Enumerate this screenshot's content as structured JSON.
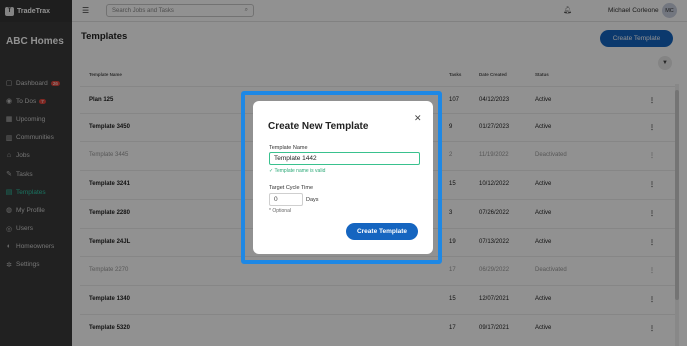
{
  "app": {
    "logo_text": "TradeTrax",
    "company": "ABC Homes"
  },
  "sidebar": {
    "items": [
      {
        "label": "Dashboard",
        "icon": "dashboard-icon",
        "glyph": "▢",
        "badge": "26"
      },
      {
        "label": "To Dos",
        "icon": "todo-icon",
        "glyph": "◉",
        "badge": "7"
      },
      {
        "label": "Upcoming",
        "icon": "calendar-icon",
        "glyph": "▦",
        "badge": ""
      },
      {
        "label": "Communities",
        "icon": "building-icon",
        "glyph": "▥",
        "badge": ""
      },
      {
        "label": "Jobs",
        "icon": "home-icon",
        "glyph": "⌂",
        "badge": ""
      },
      {
        "label": "Tasks",
        "icon": "wrench-icon",
        "glyph": "✎",
        "badge": ""
      },
      {
        "label": "Templates",
        "icon": "templates-icon",
        "glyph": "▤",
        "badge": "",
        "active": true
      },
      {
        "label": "My Profile",
        "icon": "user-icon",
        "glyph": "◍",
        "badge": ""
      },
      {
        "label": "Users",
        "icon": "users-icon",
        "glyph": "◎",
        "badge": ""
      },
      {
        "label": "Homeowners",
        "icon": "homeowners-icon",
        "glyph": "◐",
        "badge": ""
      },
      {
        "label": "Settings",
        "icon": "gear-icon",
        "glyph": "✲",
        "badge": ""
      }
    ]
  },
  "topbar": {
    "search_placeholder": "Search Jobs and Tasks",
    "user_name": "Michael Corleone",
    "avatar_initials": "MC"
  },
  "page": {
    "title": "Templates",
    "create_button": "Create Template"
  },
  "table": {
    "headers": [
      "Template Name",
      "Tasks",
      "Date Created",
      "Status"
    ],
    "rows": [
      {
        "name": "Plan 125",
        "tasks": "107",
        "date": "04/12/2023",
        "status": "Active",
        "inactive": false
      },
      {
        "name": "Template 3450",
        "tasks": "9",
        "date": "01/27/2023",
        "status": "Active",
        "inactive": false
      },
      {
        "name": "Template 3445",
        "tasks": "2",
        "date": "11/19/2022",
        "status": "Deactivated",
        "inactive": true
      },
      {
        "name": "Template 3241",
        "tasks": "15",
        "date": "10/12/2022",
        "status": "Active",
        "inactive": false
      },
      {
        "name": "Template 2280",
        "tasks": "3",
        "date": "07/26/2022",
        "status": "Active",
        "inactive": false
      },
      {
        "name": "Template 24JL",
        "tasks": "19",
        "date": "07/13/2022",
        "status": "Active",
        "inactive": false
      },
      {
        "name": "Template 2270",
        "tasks": "17",
        "date": "06/29/2022",
        "status": "Deactivated",
        "inactive": true
      },
      {
        "name": "Template 1340",
        "tasks": "15",
        "date": "12/07/2021",
        "status": "Active",
        "inactive": false
      },
      {
        "name": "Template 5320",
        "tasks": "17",
        "date": "09/17/2021",
        "status": "Active",
        "inactive": false
      }
    ],
    "row_menu_glyph": "⋮"
  },
  "modal": {
    "title": "Create New Template",
    "name_label": "Template Name",
    "name_value": "Template 1442",
    "valid_text": "✓ Template name is valid",
    "cycle_label": "Target Cycle Time",
    "cycle_value": "0",
    "days_label": "Days",
    "optional_text": "* Optional",
    "submit_label": "Create Template"
  },
  "colors": {
    "sidebar": "#3a3a3a",
    "accent": "#1565c0",
    "active": "#2dc9a8",
    "valid": "#2aa876",
    "focus_frame": "#1e88e5"
  }
}
